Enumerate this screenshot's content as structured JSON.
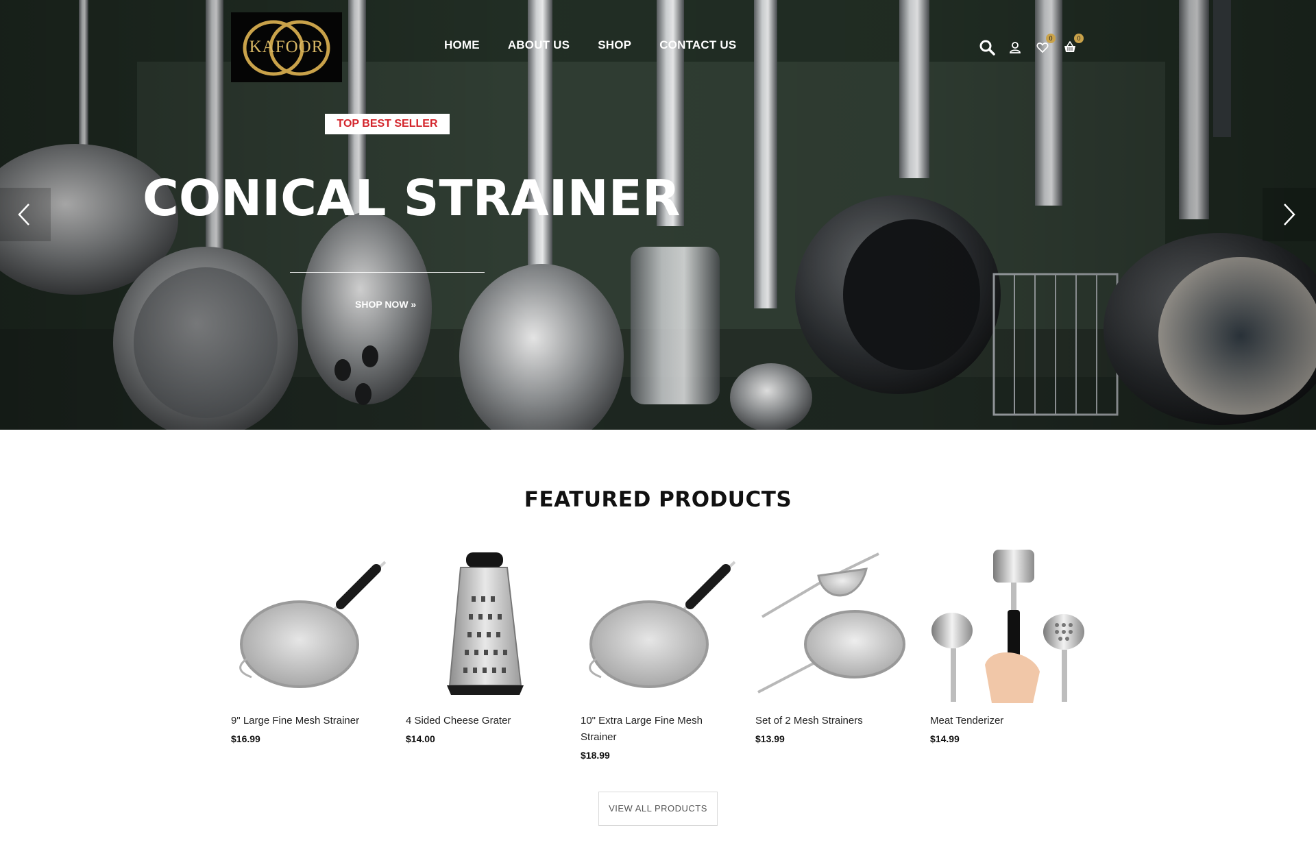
{
  "header": {
    "logo_text": "KAFOOR",
    "nav": [
      {
        "label": "HOME"
      },
      {
        "label": "ABOUT US"
      },
      {
        "label": "SHOP"
      },
      {
        "label": "CONTACT US"
      }
    ],
    "icons": {
      "search": "search-icon",
      "account": "user-icon",
      "wishlist": "heart-icon",
      "cart": "basket-icon"
    },
    "wishlist_count": "0",
    "cart_count": "0"
  },
  "hero": {
    "tag": "TOP BEST SELLER",
    "title": "CONICAL STRAINER",
    "cta": "SHOP NOW »",
    "prev_icon": "chevron-left-icon",
    "next_icon": "chevron-right-icon"
  },
  "featured": {
    "title": "FEATURED PRODUCTS",
    "products": [
      {
        "name": "9\" Large Fine Mesh Strainer",
        "price": "$16.99",
        "image": "strainer"
      },
      {
        "name": "4 Sided Cheese Grater",
        "price": "$14.00",
        "image": "grater"
      },
      {
        "name": "10\" Extra Large Fine Mesh Strainer",
        "price": "$18.99",
        "image": "strainer"
      },
      {
        "name": "Set of 2 Mesh Strainers",
        "price": "$13.99",
        "image": "strainer-set"
      },
      {
        "name": "Meat Tenderizer",
        "price": "$14.99",
        "image": "tenderizer"
      }
    ],
    "view_all": "VIEW ALL PRODUCTS"
  },
  "colors": {
    "accent_gold": "#c9a24a",
    "tag_red": "#d3232a",
    "text_dark": "#111111"
  }
}
